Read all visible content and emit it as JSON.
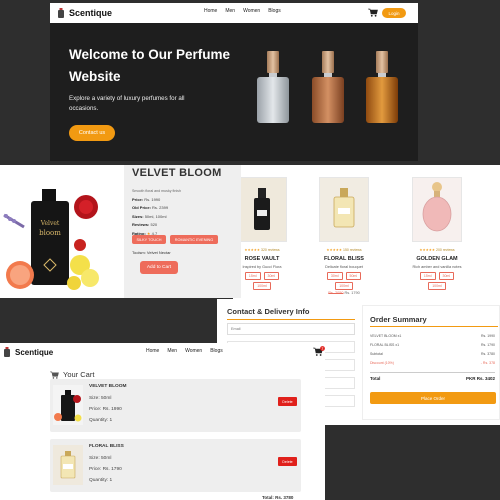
{
  "hero": {
    "brand": "Scentique",
    "nav": [
      "Home",
      "Men",
      "Women",
      "Blogs"
    ],
    "login_label": "Login",
    "title": "Welcome to Our Perfume Website",
    "subtitle": "Explore a variety of luxury perfumes for all occasions.",
    "contact_label": "Contact us"
  },
  "detail": {
    "title": "VELVET BLOOM",
    "bottle_label_1": "Velvet",
    "bottle_label_2": "bloom",
    "description": "Smooth floral and musky finish",
    "price": {
      "label": "Price:",
      "value": "Rs. 1990"
    },
    "old_price": {
      "label": "Old Price:",
      "value": "Rs. 2399"
    },
    "sizes": {
      "label": "Sizes:",
      "value": "50ml, 100ml"
    },
    "reviews": {
      "label": "Reviews:",
      "value": "520"
    },
    "rating": {
      "label": "Rating:",
      "value": "4.7"
    },
    "tags": [
      "SILKY TOUCH",
      "ROMANTIC EVENING"
    ],
    "toolsm": "Toolsm: Velvet Nectar",
    "add_to_cart_label": "Add to Cart",
    "colors": {
      "accent": "#ee6c5b"
    }
  },
  "products": {
    "items": [
      {
        "stars": "★★★★★",
        "reviews": "320 reviews",
        "name": "ROSE VAULT",
        "desc": "Inspired by Gucci Flora",
        "sizes": [
          "15ml",
          "30ml"
        ],
        "size_extra": "100ml",
        "old_price": "",
        "price": ""
      },
      {
        "stars": "★★★★★",
        "reviews": "150 reviews",
        "name": "FLORAL BLISS",
        "desc": "Delicate floral bouquet",
        "sizes": [
          "30ml",
          "50ml"
        ],
        "size_extra": "100ml",
        "old_price": "Rs. 2050",
        "price": "Rs. 1790"
      },
      {
        "stars": "★★★★★",
        "reviews": "200 reviews",
        "name": "GOLDEN GLAM",
        "desc": "Rich amber and vanilla notes",
        "sizes": [
          "15ml",
          "30ml"
        ],
        "size_extra": "100ml",
        "old_price": "",
        "price": ""
      }
    ]
  },
  "checkout": {
    "contact_title": "Contact & Delivery Info",
    "email_placeholder": "Email",
    "summary_title": "Order Summary",
    "rows": [
      {
        "label": "VELVET BLOOM x1",
        "value": "Rs. 1990"
      },
      {
        "label": "FLORAL BLISS x1",
        "value": "Rs. 1790"
      },
      {
        "label": "Subtotal",
        "value": "Rs. 3780"
      }
    ],
    "discount": {
      "label": "Discount (10%)",
      "value": "- Rs. 378"
    },
    "total": {
      "label": "Total",
      "value": "PKR Rs. 3402"
    },
    "place_order_label": "Place Order"
  },
  "cart": {
    "brand": "Scentique",
    "nav": [
      "Home",
      "Men",
      "Women",
      "Blogs"
    ],
    "cart_count": "2",
    "title": "Your Cart",
    "items": [
      {
        "name": "VELVET BLOOM",
        "size": "Size: 50ml",
        "price": "Price: Rs. 1990",
        "qty": "Quantity: 1",
        "delete_label": "Delete"
      },
      {
        "name": "FLORAL BLISS",
        "size": "Size: 50ml",
        "price": "Price: Rs. 1790",
        "qty": "Quantity: 1",
        "delete_label": "Delete"
      }
    ],
    "total_partial": "Total: Rs. 3780"
  },
  "colors": {
    "brand_orange": "#f29a12",
    "dark_bg": "#1e1e1e",
    "page_bg": "#2e2e2e",
    "delete_red": "#e0201b"
  }
}
